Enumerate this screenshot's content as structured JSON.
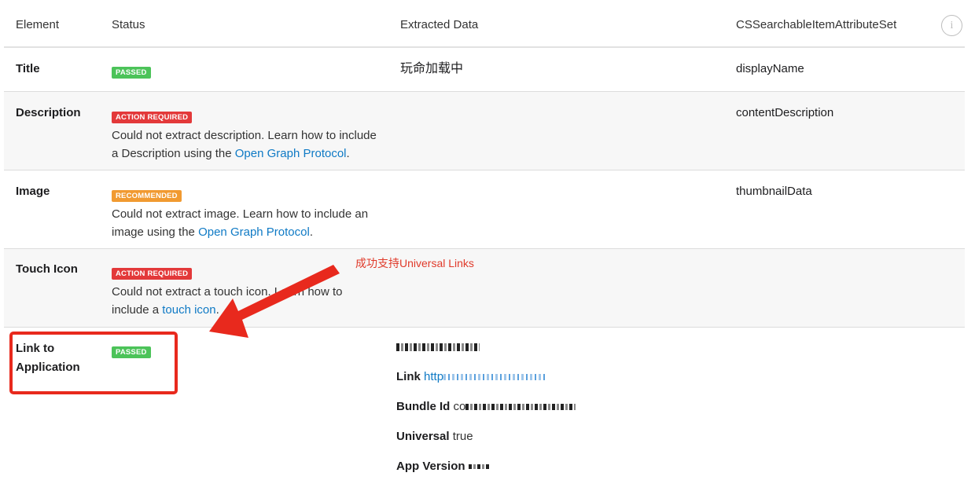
{
  "columns": {
    "element": "Element",
    "status": "Status",
    "extracted": "Extracted Data",
    "attribute": "CSSearchableItemAttributeSet"
  },
  "info_icon": "i",
  "rows": [
    {
      "element": "Title",
      "badge": "PASSED",
      "extracted": "玩命加载中",
      "attribute": "displayName"
    },
    {
      "element": "Description",
      "badge": "ACTION REQUIRED",
      "message_pre": "Could not extract description. Learn how to include a Description using the ",
      "message_link": "Open Graph Protocol",
      "message_post": ".",
      "attribute": "contentDescription"
    },
    {
      "element": "Image",
      "badge": "RECOMMENDED",
      "message_pre": "Could not extract image. Learn how to include an image using the ",
      "message_link": "Open Graph Protocol",
      "message_post": ".",
      "attribute": "thumbnailData"
    },
    {
      "element": "Touch Icon",
      "badge": "ACTION REQUIRED",
      "message_pre": "Could not extract a touch icon. Learn how to include a ",
      "message_link": "touch icon",
      "message_post": "."
    },
    {
      "element": "Link to Application",
      "badge": "PASSED",
      "details": {
        "link_label": "Link",
        "link_value": "http",
        "bundle_label": "Bundle Id",
        "bundle_value": "co",
        "universal_label": "Universal",
        "universal_value": "true",
        "version_label": "App Version"
      }
    }
  ],
  "annotation": "成功支持Universal Links",
  "colors": {
    "passed": "#4cc359",
    "action_required": "#e3393a",
    "recommended": "#f19a31",
    "link": "#0f7ac5",
    "annotation": "#e8291d"
  }
}
